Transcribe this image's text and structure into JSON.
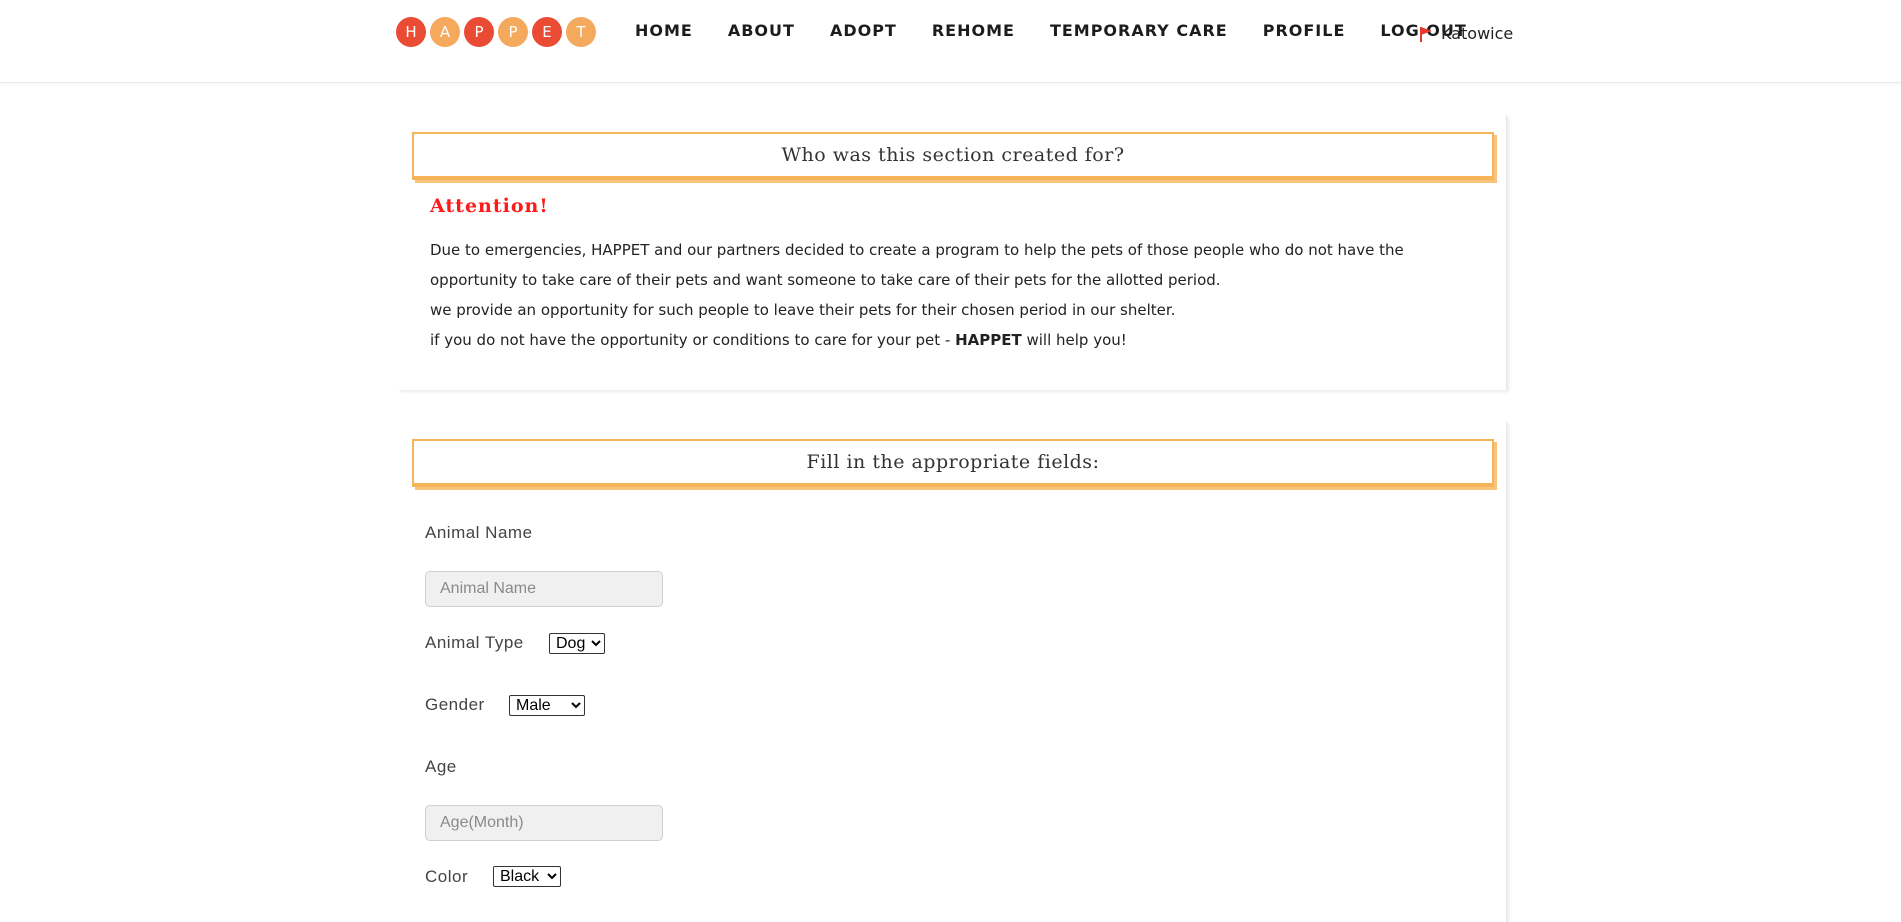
{
  "header": {
    "logo_letters": [
      {
        "letter": "H",
        "color": "#e94b35"
      },
      {
        "letter": "A",
        "color": "#f5a95c"
      },
      {
        "letter": "P",
        "color": "#e94b35"
      },
      {
        "letter": "P",
        "color": "#f5a95c"
      },
      {
        "letter": "E",
        "color": "#e94b35"
      },
      {
        "letter": "T",
        "color": "#f5a95c"
      }
    ],
    "nav": [
      "HOME",
      "ABOUT",
      "ADOPT",
      "REHOME",
      "TEMPORARY CARE",
      "PROFILE",
      "LOG OUT"
    ],
    "city": "Katowice",
    "city_icon": "flag-icon"
  },
  "info_card": {
    "title": "Who was this section created for?",
    "attention": "Attention!",
    "line1": "Due to emergencies, HAPPET and our partners decided to create a program to help the pets of those people who do not have the opportunity to take care of their pets and want someone to take care of their pets for the allotted period.",
    "line2": "we provide an opportunity for such people to leave their pets for their chosen period in our shelter.",
    "line3_prefix": "if you do not have the opportunity or conditions to care for your pet - ",
    "line3_bold": "HAPPET",
    "line3_suffix": " will help you!"
  },
  "form": {
    "title": "Fill in the appropriate fields:",
    "animal_name_label": "Animal Name",
    "animal_name_placeholder": "Animal Name",
    "animal_type_label": "Animal Type",
    "animal_type_value": "Dog",
    "gender_label": "Gender",
    "gender_value": "Male",
    "age_label": "Age",
    "age_placeholder": "Age(Month)",
    "color_label": "Color",
    "color_value": "Black"
  },
  "colors": {
    "accent_orange": "#f5b459",
    "attention_red": "#ff1a1a",
    "logo_red": "#e94b35",
    "logo_orange": "#f5a95c"
  }
}
